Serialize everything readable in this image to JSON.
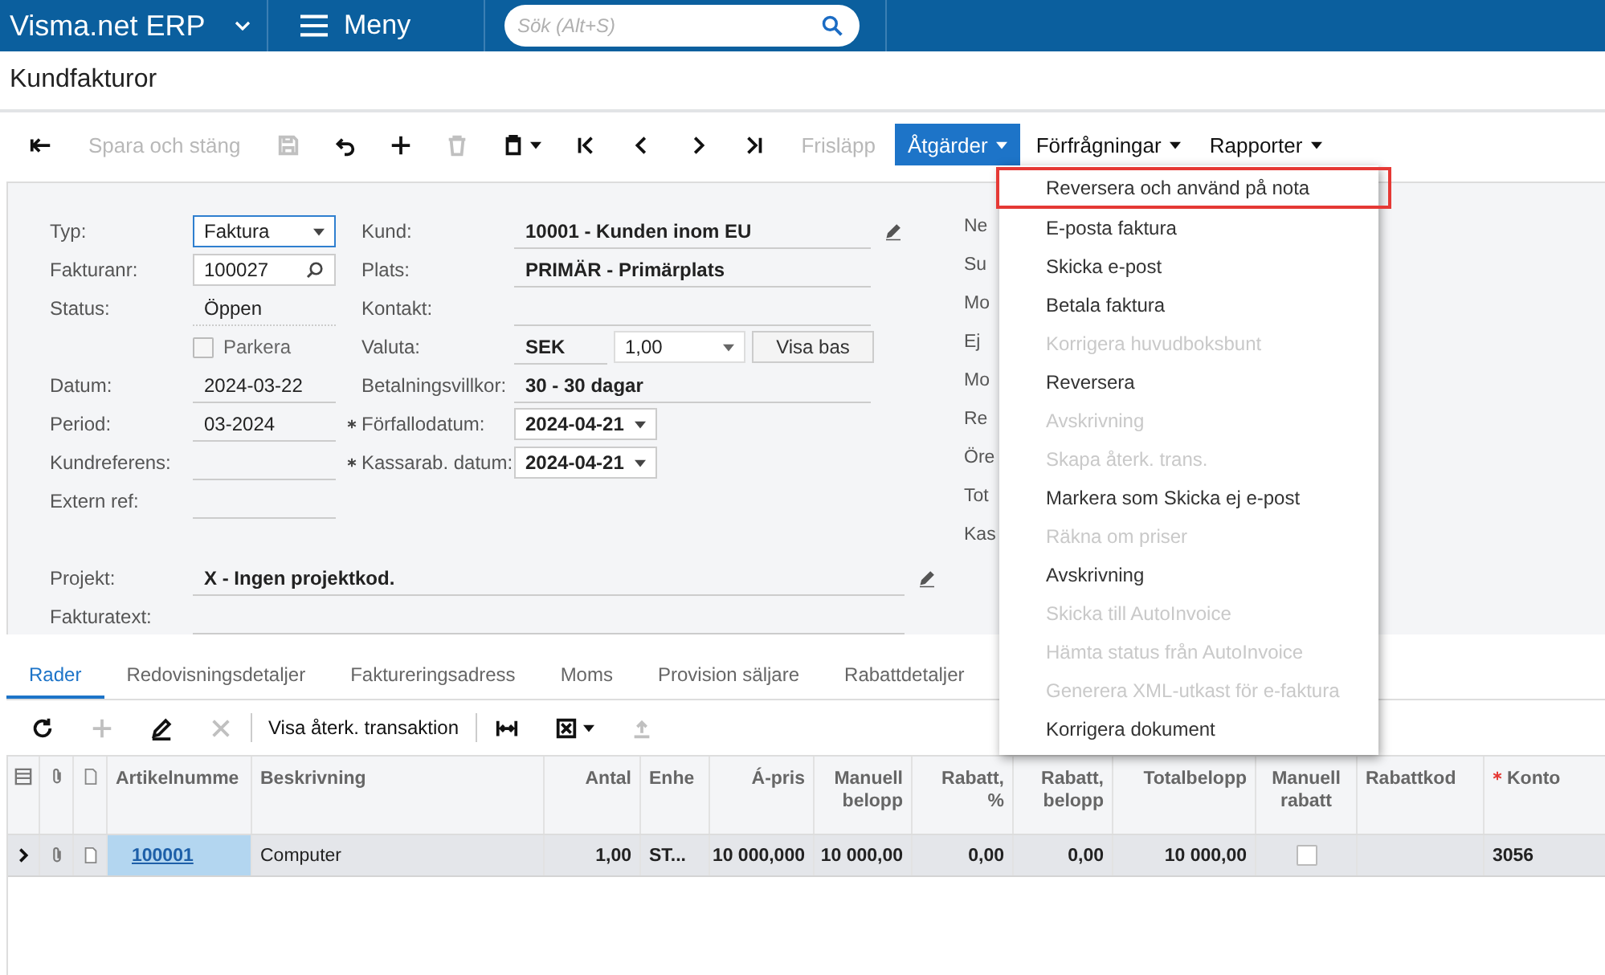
{
  "top_bar": {
    "product": "Visma.net ERP",
    "menu_label": "Meny",
    "search": {
      "placeholder": "Sök (Alt+S)"
    }
  },
  "page_title": "Kundfakturor",
  "toolbar": [
    {
      "kind": "icon",
      "disabled": false
    },
    {
      "kind": "text",
      "label": "Spara och stäng",
      "disabled": true
    },
    {
      "kind": "icon",
      "disabled": true
    },
    {
      "kind": "icon",
      "disabled": false
    },
    {
      "kind": "icon",
      "disabled": false
    },
    {
      "kind": "icon",
      "disabled": true
    },
    {
      "kind": "icon-menu",
      "disabled": false
    },
    {
      "kind": "icon",
      "disabled": false
    },
    {
      "kind": "icon",
      "disabled": false
    },
    {
      "kind": "icon",
      "disabled": false
    },
    {
      "kind": "icon",
      "disabled": false
    },
    {
      "kind": "text",
      "label": "Frisläpp",
      "disabled": true
    },
    {
      "kind": "menu",
      "label": "Åtgärder",
      "selected": true
    },
    {
      "kind": "menu",
      "label": "Förfrågningar",
      "selected": false
    },
    {
      "kind": "menu",
      "label": "Rapporter",
      "selected": false
    }
  ],
  "form": {
    "left": [
      {
        "kind": "select",
        "label": "Typ:",
        "value": "Faktura"
      },
      {
        "kind": "search",
        "label": "Fakturanr:",
        "value": "100027"
      },
      {
        "kind": "text",
        "label": "Status:",
        "value": "Öppen"
      },
      {
        "kind": "checkbox",
        "label": "Parkera",
        "checked": false
      },
      {
        "kind": "text",
        "label": "Datum:",
        "value": "2024-03-22"
      },
      {
        "kind": "text",
        "label": "Period:",
        "value": "03-2024"
      },
      {
        "kind": "text",
        "label": "Kundreferens:"
      },
      {
        "kind": "text",
        "label": "Extern ref:"
      }
    ],
    "middle": [
      {
        "kind": "text",
        "label": "Kund:",
        "value": "10001 - Kunden inom EU",
        "editable": true
      },
      {
        "kind": "text",
        "label": "Plats:",
        "value": "PRIMÄR - Primärplats"
      },
      {
        "kind": "text",
        "label": "Kontakt:"
      },
      {
        "kind": "currency",
        "label": "Valuta:",
        "value": "SEK",
        "rate": "1,00",
        "button": "Visa bas"
      },
      {
        "kind": "text",
        "label": "Betalningsvillkor:",
        "value": "30 - 30 dagar"
      },
      {
        "kind": "date",
        "label": "Förfallodatum:",
        "value": "2024-04-21",
        "required": true
      },
      {
        "kind": "date",
        "label": "Kassarab. datum:",
        "value": "2024-04-21",
        "required": true
      }
    ],
    "right": [
      "Ne",
      "Su",
      "Mo",
      "Ej",
      "Mo",
      "Re",
      "Öre",
      "Tot",
      "Kas"
    ],
    "wide": [
      {
        "label": "Projekt:",
        "value": "X - Ingen projektkod.",
        "editable": true
      },
      {
        "label": "Fakturatext:"
      }
    ]
  },
  "tabs": [
    {
      "label": "Rader",
      "selected": true
    },
    {
      "label": "Redovisningsdetaljer",
      "selected": false
    },
    {
      "label": "Faktureringsadress",
      "selected": false
    },
    {
      "label": "Moms",
      "selected": false
    },
    {
      "label": "Provision säljare",
      "selected": false
    },
    {
      "label": "Rabattdetaljer",
      "selected": false
    }
  ],
  "grid_toolbar": [
    {
      "kind": "icon",
      "disabled": false
    },
    {
      "kind": "icon",
      "disabled": true
    },
    {
      "kind": "icon",
      "disabled": false
    },
    {
      "kind": "icon",
      "disabled": true
    },
    {
      "kind": "text",
      "label": "Visa återk. transaktion",
      "disabled": false
    },
    {
      "kind": "icon",
      "disabled": false
    },
    {
      "kind": "icon-menu",
      "disabled": false
    },
    {
      "kind": "icon",
      "disabled": true
    }
  ],
  "table": {
    "columns": [
      {
        "label": "Artikelnumme",
        "required": false
      },
      {
        "label": "Beskrivning",
        "required": false
      },
      {
        "label": "Antal",
        "required": false
      },
      {
        "label": "Enhe",
        "required": false
      },
      {
        "label": "Á-pris",
        "required": false
      },
      {
        "label": "Manuell belopp",
        "required": false
      },
      {
        "label": "Rabatt, %",
        "required": false
      },
      {
        "label": "Rabatt, belopp",
        "required": false
      },
      {
        "label": "Totalbelopp",
        "required": false
      },
      {
        "label": "Manuell rabatt",
        "required": false
      },
      {
        "label": "Rabattkod",
        "required": false
      },
      {
        "label": "Konto",
        "required": true
      }
    ],
    "rows": [
      {
        "cells": [
          {
            "kind": "link",
            "text": "100001",
            "selected": true
          },
          {
            "kind": "text",
            "text": "Computer"
          },
          {
            "kind": "text",
            "text": "1,00"
          },
          {
            "kind": "text",
            "text": "ST..."
          },
          {
            "kind": "text",
            "text": "10 000,000"
          },
          {
            "kind": "text",
            "text": "10 000,00"
          },
          {
            "kind": "text",
            "text": "0,00"
          },
          {
            "kind": "text",
            "text": "0,00"
          },
          {
            "kind": "text",
            "text": "10 000,00"
          },
          {
            "kind": "checkbox",
            "checked": false
          },
          {
            "kind": "empty"
          },
          {
            "kind": "text",
            "text": "3056"
          }
        ]
      }
    ]
  },
  "actions_menu": [
    {
      "label": "Reversera och använd på nota",
      "disabled": false,
      "outlined": true
    },
    {
      "label": "E-posta faktura",
      "disabled": false,
      "outlined": false
    },
    {
      "label": "Skicka e-post",
      "disabled": false,
      "outlined": false
    },
    {
      "label": "Betala faktura",
      "disabled": false,
      "outlined": false
    },
    {
      "label": "Korrigera huvudboksbunt",
      "disabled": true,
      "outlined": false
    },
    {
      "label": "Reversera",
      "disabled": false,
      "outlined": false
    },
    {
      "label": "Avskrivning",
      "disabled": true,
      "outlined": false
    },
    {
      "label": "Skapa återk. trans.",
      "disabled": true,
      "outlined": false
    },
    {
      "label": "Markera som Skicka ej e-post",
      "disabled": false,
      "outlined": false
    },
    {
      "label": "Räkna om priser",
      "disabled": true,
      "outlined": false
    },
    {
      "label": "Avskrivning",
      "disabled": false,
      "outlined": false
    },
    {
      "label": "Skicka till AutoInvoice",
      "disabled": true,
      "outlined": false
    },
    {
      "label": "Hämta status från AutoInvoice",
      "disabled": true,
      "outlined": false
    },
    {
      "label": "Generera XML-utkast för e-faktura",
      "disabled": true,
      "outlined": false
    },
    {
      "label": "Korrigera dokument",
      "disabled": false,
      "outlined": false
    }
  ]
}
